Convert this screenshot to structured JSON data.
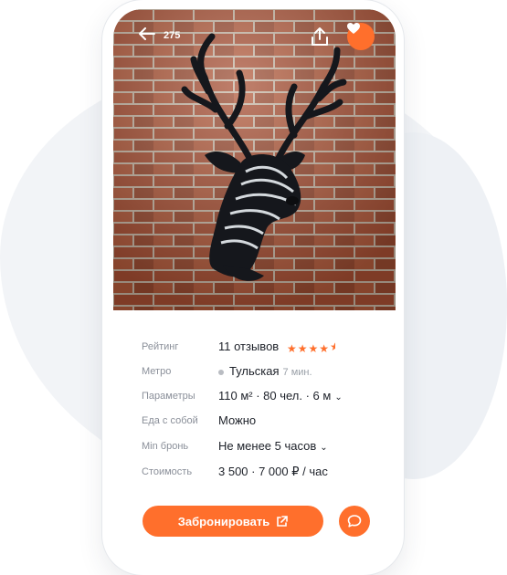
{
  "header": {
    "back_icon": "arrow-left-icon",
    "photo_count": "275",
    "share_icon": "share-icon",
    "favorite_icon": "heart-icon"
  },
  "details": [
    {
      "label": "Рейтинг",
      "value": "11 отзывов",
      "rating": 4.5
    },
    {
      "label": "Метро",
      "value": "Тульская",
      "extra": "7 мин."
    },
    {
      "label": "Параметры",
      "value": "110 м² · 80 чел. · 6 м",
      "chevron": "⌄"
    },
    {
      "label": "Еда с собой",
      "value": "Можно"
    },
    {
      "label": "Min бронь",
      "value": "Не менее 5 часов",
      "chevron": "⌄"
    },
    {
      "label": "Стоимость",
      "value": "3 500 · 7 000 ₽ / час"
    }
  ],
  "actions": {
    "book_label": "Забронировать",
    "book_icon": "external-link-icon",
    "chat_icon": "chat-bubble-icon"
  },
  "colors": {
    "accent": "#ff6f2c",
    "text": "#1d2129",
    "muted": "#8a8f99"
  }
}
